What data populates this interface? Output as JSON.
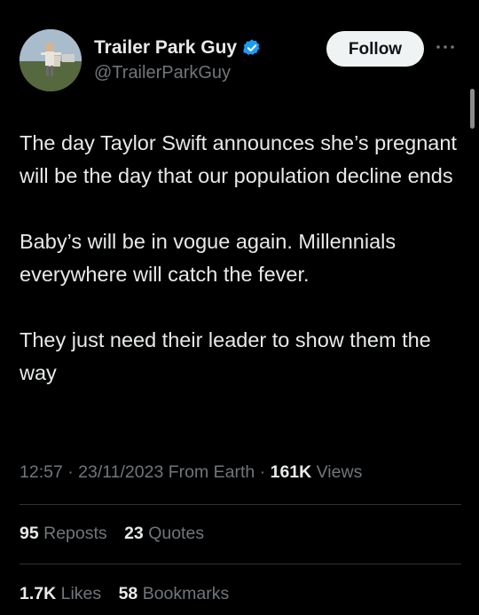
{
  "author": {
    "display_name": "Trailer Park Guy",
    "handle": "@TrailerParkGuy",
    "verified": true,
    "verified_color": "#1d9bf0"
  },
  "actions": {
    "follow_label": "Follow",
    "more_icon": "more-horizontal-icon"
  },
  "tweet": {
    "paragraphs": [
      "The day Taylor Swift announces she’s pregnant will be the day that our population decline ends",
      "Baby’s will be in vogue again. Millennials everywhere will catch the fever.",
      "They just need their leader to show them the way"
    ]
  },
  "meta": {
    "time": "12:57",
    "separator": " · ",
    "date": "23/11/2023",
    "source": "From Earth",
    "views_count": "161K",
    "views_label": " Views"
  },
  "stats": {
    "reposts_count": "95",
    "reposts_label": " Reposts",
    "quotes_count": "23",
    "quotes_label": " Quotes",
    "likes_count": "1.7K",
    "likes_label": " Likes",
    "bookmarks_count": "58",
    "bookmarks_label": " Bookmarks"
  },
  "colors": {
    "background": "#000000",
    "text_primary": "#e7e9ea",
    "text_secondary": "#71767b",
    "divider": "#2f3336",
    "follow_bg": "#eff3f4"
  }
}
